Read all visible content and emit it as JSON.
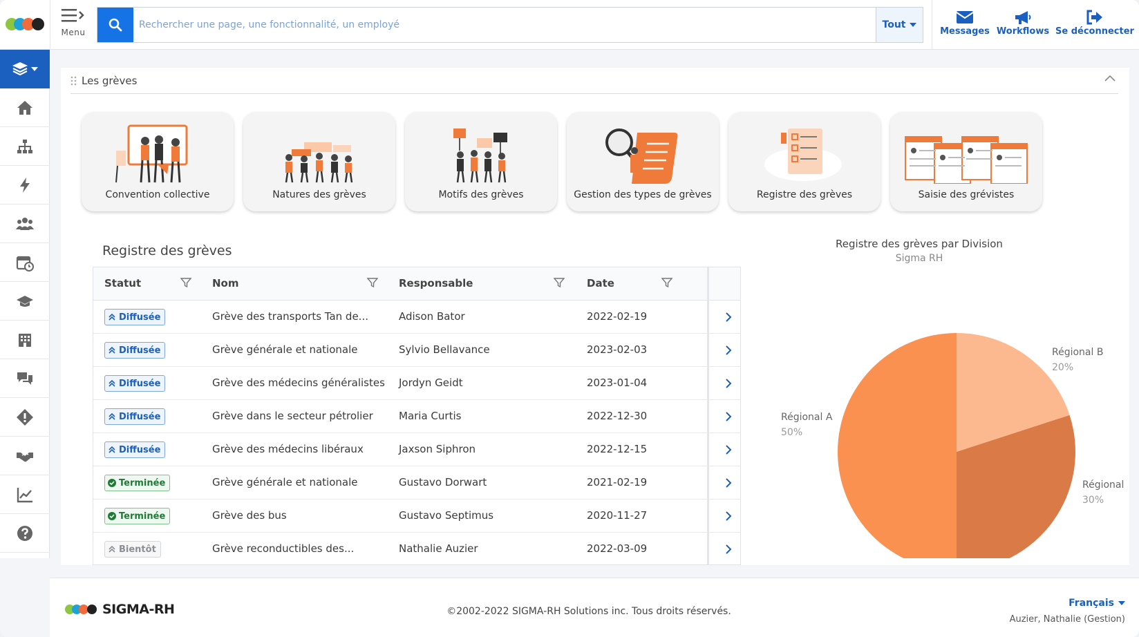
{
  "topbar": {
    "menu_label": "Menu",
    "search_placeholder": "Rechercher une page, une fonctionnalité, un employé",
    "scope_label": "Tout",
    "actions": [
      {
        "label": "Messages",
        "icon": "envelope-icon"
      },
      {
        "label": "Workflows",
        "icon": "megaphone-icon"
      },
      {
        "label": "Se déconnecter",
        "icon": "logout-icon"
      }
    ]
  },
  "sidebar": {
    "items": [
      {
        "icon": "home-icon"
      },
      {
        "icon": "org-chart-icon"
      },
      {
        "icon": "lightning-icon"
      },
      {
        "icon": "people-icon"
      },
      {
        "icon": "calendar-clock-icon"
      },
      {
        "icon": "graduation-cap-icon"
      },
      {
        "icon": "building-icon"
      },
      {
        "icon": "chat-bubbles-icon"
      },
      {
        "icon": "warning-diamond-icon"
      },
      {
        "icon": "handshake-icon"
      },
      {
        "icon": "chart-line-icon"
      },
      {
        "icon": "help-icon"
      }
    ]
  },
  "panel": {
    "title": "Les grèves",
    "tiles": [
      {
        "label": "Convention collective"
      },
      {
        "label": "Natures des grèves"
      },
      {
        "label": "Motifs des grèves"
      },
      {
        "label": "Gestion des types de grèves"
      },
      {
        "label": "Registre des grèves"
      },
      {
        "label": "Saisie des grévistes"
      }
    ]
  },
  "table": {
    "title": "Registre des grèves",
    "headers": {
      "status": "Statut",
      "name": "Nom",
      "owner": "Responsable",
      "date": "Date"
    },
    "rows": [
      {
        "status": "Diffusée",
        "kind": "blue",
        "name": "Grève des transports Tan de...",
        "owner": "Adison Bator",
        "date": "2022-02-19"
      },
      {
        "status": "Diffusée",
        "kind": "blue",
        "name": "Grève générale et nationale",
        "owner": "Sylvio Bellavance",
        "date": "2023-02-03"
      },
      {
        "status": "Diffusée",
        "kind": "blue",
        "name": "Grève des médecins généralistes",
        "owner": "Jordyn Geidt",
        "date": "2023-01-04"
      },
      {
        "status": "Diffusée",
        "kind": "blue",
        "name": "Grève dans le secteur pétrolier",
        "owner": "Maria Curtis",
        "date": "2022-12-30"
      },
      {
        "status": "Diffusée",
        "kind": "blue",
        "name": "Grève des médecins libéraux",
        "owner": "Jaxson Siphron",
        "date": "2022-12-15"
      },
      {
        "status": "Terminée",
        "kind": "green",
        "name": "Grève générale et nationale",
        "owner": "Gustavo Dorwart",
        "date": "2021-02-19"
      },
      {
        "status": "Terminée",
        "kind": "green",
        "name": "Grève des bus",
        "owner": "Gustavo Septimus",
        "date": "2020-11-27"
      },
      {
        "status": "Bientôt",
        "kind": "grey",
        "name": "Grève reconductibles des...",
        "owner": "Nathalie Auzier",
        "date": "2022-03-09"
      }
    ]
  },
  "chart_data": {
    "type": "pie",
    "title": "Registre des grèves par Division",
    "subtitle": "Sigma RH",
    "series": [
      {
        "name": "Régional A",
        "value": 50,
        "label": "50%",
        "color": "#fa9150"
      },
      {
        "name": "Régional B",
        "value": 20,
        "label": "20%",
        "color": "#fcb98f"
      },
      {
        "name": "Régional C",
        "value": 30,
        "label": "30%",
        "color": "#d97a47"
      }
    ]
  },
  "footer": {
    "brand": "SIGMA-RH",
    "copyright": "©2002-2022 SIGMA-RH Solutions inc. Tous droits réservés.",
    "language": "Français",
    "user": "Auzier, Nathalie (Gestion)"
  },
  "colors": {
    "primary": "#1b5fbf",
    "accent_search": "#1673e6",
    "orange": "#fa9150"
  }
}
